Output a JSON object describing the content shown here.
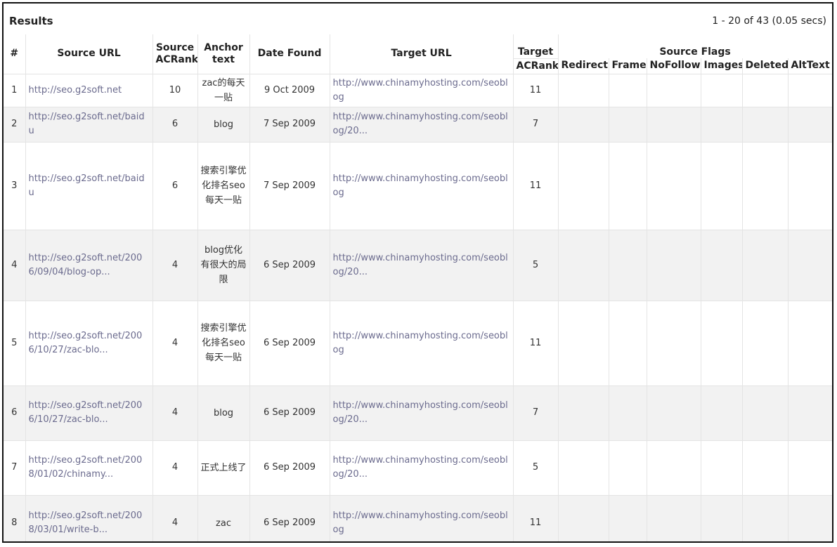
{
  "results": {
    "title": "Results",
    "count_text": "1 - 20 of 43 (0.05 secs)"
  },
  "columns": {
    "index": "#",
    "source_url": "Source URL",
    "source_acrank": "Source ACRank",
    "anchor_text": "Anchor text",
    "date_found": "Date Found",
    "target_url": "Target URL",
    "target_acrank": "Target ACRank",
    "source_flags": "Source Flags",
    "flags": [
      "Redirect",
      "Frame",
      "NoFollow",
      "Images",
      "Deleted",
      "AltText"
    ]
  },
  "rows": [
    {
      "index": "1",
      "source_url": "http://seo.g2soft.net",
      "source_acrank": "10",
      "anchor_text": "zac的每天一贴",
      "date_found": "9 Oct 2009",
      "target_url": "http://www.chinamyhosting.com/seoblog",
      "target_acrank": "11"
    },
    {
      "index": "2",
      "source_url": "http://seo.g2soft.net/baidu",
      "source_acrank": "6",
      "anchor_text": "blog",
      "date_found": "7 Sep 2009",
      "target_url": "http://www.chinamyhosting.com/seoblog/20...",
      "target_acrank": "7"
    },
    {
      "index": "3",
      "source_url": "http://seo.g2soft.net/baidu",
      "source_acrank": "6",
      "anchor_text": "搜索引擎优化排名seo每天一贴",
      "date_found": "7 Sep 2009",
      "target_url": "http://www.chinamyhosting.com/seoblog",
      "target_acrank": "11"
    },
    {
      "index": "4",
      "source_url": "http://seo.g2soft.net/2006/09/04/blog-op...",
      "source_acrank": "4",
      "anchor_text": "blog优化有很大的局限",
      "date_found": "6 Sep 2009",
      "target_url": "http://www.chinamyhosting.com/seoblog/20...",
      "target_acrank": "5"
    },
    {
      "index": "5",
      "source_url": "http://seo.g2soft.net/2006/10/27/zac-blo...",
      "source_acrank": "4",
      "anchor_text": "搜索引擎优化排名seo每天一贴",
      "date_found": "6 Sep 2009",
      "target_url": "http://www.chinamyhosting.com/seoblog",
      "target_acrank": "11"
    },
    {
      "index": "6",
      "source_url": "http://seo.g2soft.net/2006/10/27/zac-blo...",
      "source_acrank": "4",
      "anchor_text": "blog",
      "date_found": "6 Sep 2009",
      "target_url": "http://www.chinamyhosting.com/seoblog/20...",
      "target_acrank": "7"
    },
    {
      "index": "7",
      "source_url": "http://seo.g2soft.net/2008/01/02/chinamy...",
      "source_acrank": "4",
      "anchor_text": "正式上线了",
      "date_found": "6 Sep 2009",
      "target_url": "http://www.chinamyhosting.com/seoblog/20...",
      "target_acrank": "5"
    },
    {
      "index": "8",
      "source_url": "http://seo.g2soft.net/2008/03/01/write-b...",
      "source_acrank": "4",
      "anchor_text": "zac",
      "date_found": "6 Sep 2009",
      "target_url": "http://www.chinamyhosting.com/seoblog",
      "target_acrank": "11"
    }
  ]
}
